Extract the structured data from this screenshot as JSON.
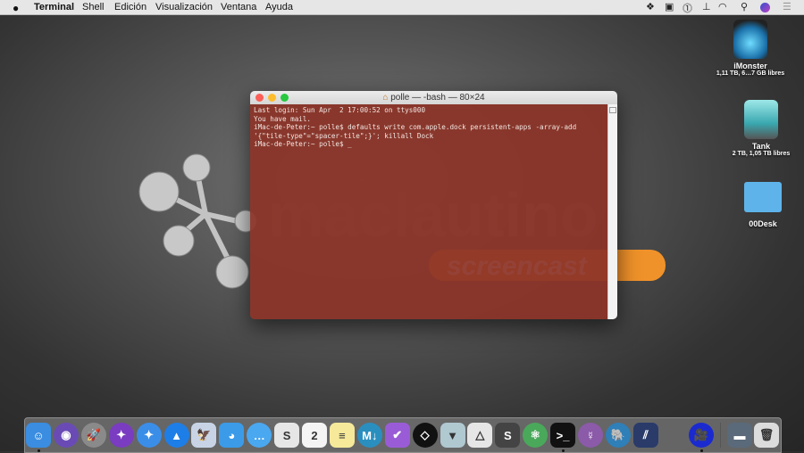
{
  "menubar": {
    "apple": "",
    "app": "Terminal",
    "items": [
      "Shell",
      "Edición",
      "Visualización",
      "Ventana",
      "Ayuda"
    ],
    "status_icons": [
      "dropbox-icon",
      "crossover-icon",
      "1password-icon",
      "broom-icon",
      "wifi-icon",
      "search-icon",
      "siri-icon",
      "notification-center-icon"
    ]
  },
  "desktop": {
    "icons": [
      {
        "name": "iMonster",
        "sub": "1,11 TB, 6…7 GB libres"
      },
      {
        "name": "Tank",
        "sub": "2 TB, 1,05 TB libres"
      },
      {
        "name": "00Desk",
        "sub": ""
      }
    ]
  },
  "watermark": {
    "text1": "maclautino",
    "text2": "screencast"
  },
  "terminal": {
    "title": "polle — -bash — 80×24",
    "lines": [
      "Last login: Sun Apr  2 17:00:52 on ttys000",
      "You have mail.",
      "iMac-de-Peter:~ polle$ defaults write com.apple.dock persistent-apps -array-add",
      "'{\"tile-type\"=\"spacer-tile\";}'; killall Dock",
      "iMac-de-Peter:~ polle$ _"
    ]
  },
  "dock": {
    "apps": [
      {
        "icon": "finder-icon",
        "color": "#3a8de0",
        "glyph": "☺",
        "running": true
      },
      {
        "icon": "siri-icon",
        "color": "#6a4bb5",
        "glyph": "◉",
        "round": true
      },
      {
        "icon": "launchpad-icon",
        "color": "#8a8a8a",
        "glyph": "🚀",
        "round": true
      },
      {
        "icon": "safari-preview-icon",
        "color": "#7a3cc0",
        "glyph": "✦",
        "round": true
      },
      {
        "icon": "safari-icon",
        "color": "#3a8ee8",
        "glyph": "✦",
        "round": true
      },
      {
        "icon": "spark-icon",
        "color": "#1e7ee8",
        "glyph": "▲",
        "round": true
      },
      {
        "icon": "preview-icon",
        "color": "#c8d4e6",
        "glyph": "🦅"
      },
      {
        "icon": "tweetbot-icon",
        "color": "#3b9be8",
        "glyph": "◕"
      },
      {
        "icon": "messages-icon",
        "color": "#4aa8f0",
        "glyph": "…",
        "round": true
      },
      {
        "icon": "slack-icon",
        "color": "#e6e6e6",
        "glyph": "S"
      },
      {
        "icon": "calendar-icon",
        "color": "#f4f4f4",
        "glyph": "2"
      },
      {
        "icon": "notes-icon",
        "color": "#f6e99a",
        "glyph": "≡"
      },
      {
        "icon": "markdown-icon",
        "color": "#2a8fbf",
        "glyph": "M↓",
        "round": true
      },
      {
        "icon": "omnifocus-icon",
        "color": "#9a5cd6",
        "glyph": "✔"
      },
      {
        "icon": "code-editor-icon",
        "color": "#111",
        "glyph": "◇",
        "round": true
      },
      {
        "icon": "transmit-icon",
        "color": "#b0c8d0",
        "glyph": "▼"
      },
      {
        "icon": "prism-icon",
        "color": "#e6e6e6",
        "glyph": "△"
      },
      {
        "icon": "sublime-text-icon",
        "color": "#444",
        "glyph": "S"
      },
      {
        "icon": "atom-icon",
        "color": "#4aa85a",
        "glyph": "⚛",
        "round": true
      },
      {
        "icon": "terminal-icon",
        "color": "#111",
        "glyph": ">_",
        "running": true
      },
      {
        "icon": "tor-icon",
        "color": "#8b5aa8",
        "glyph": "☿",
        "round": true
      },
      {
        "icon": "mamp-icon",
        "color": "#2f7fb8",
        "glyph": "🐘",
        "round": true
      },
      {
        "icon": "tools-icon",
        "color": "#2a3b6a",
        "glyph": "⫽"
      },
      {
        "icon": "spacer-tile",
        "color": "transparent",
        "glyph": ""
      },
      {
        "icon": "screenflow-icon",
        "color": "#1a2acf",
        "glyph": "🎥",
        "round": true,
        "running": true
      }
    ],
    "stacks": [
      {
        "icon": "downloads-folder-icon",
        "color": "#5a6a7a",
        "glyph": "▬"
      },
      {
        "icon": "trash-icon",
        "color": "#dcdcdc",
        "glyph": "🗑"
      }
    ]
  }
}
